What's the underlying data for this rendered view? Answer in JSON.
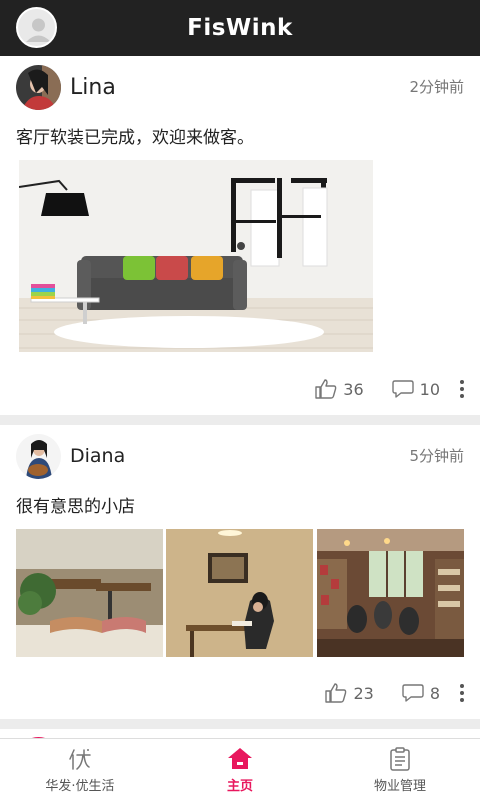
{
  "app": {
    "title": "FisWink"
  },
  "posts": [
    {
      "user": "Lina",
      "time": "2分钟前",
      "text": "客厅软装已完成，欢迎来做客。",
      "likes": "36",
      "comments": "10"
    },
    {
      "user": "Diana",
      "time": "5分钟前",
      "text": "很有意思的小店",
      "likes": "23",
      "comments": "8"
    }
  ],
  "nav": {
    "items": [
      {
        "label": "华发·优生活",
        "icon": "you-icon"
      },
      {
        "label": "主页",
        "icon": "home-icon"
      },
      {
        "label": "物业管理",
        "icon": "clipboard-icon"
      }
    ]
  },
  "colors": {
    "header_bg": "#222222",
    "accent": "#e8175d",
    "page_bg": "#ececec"
  }
}
